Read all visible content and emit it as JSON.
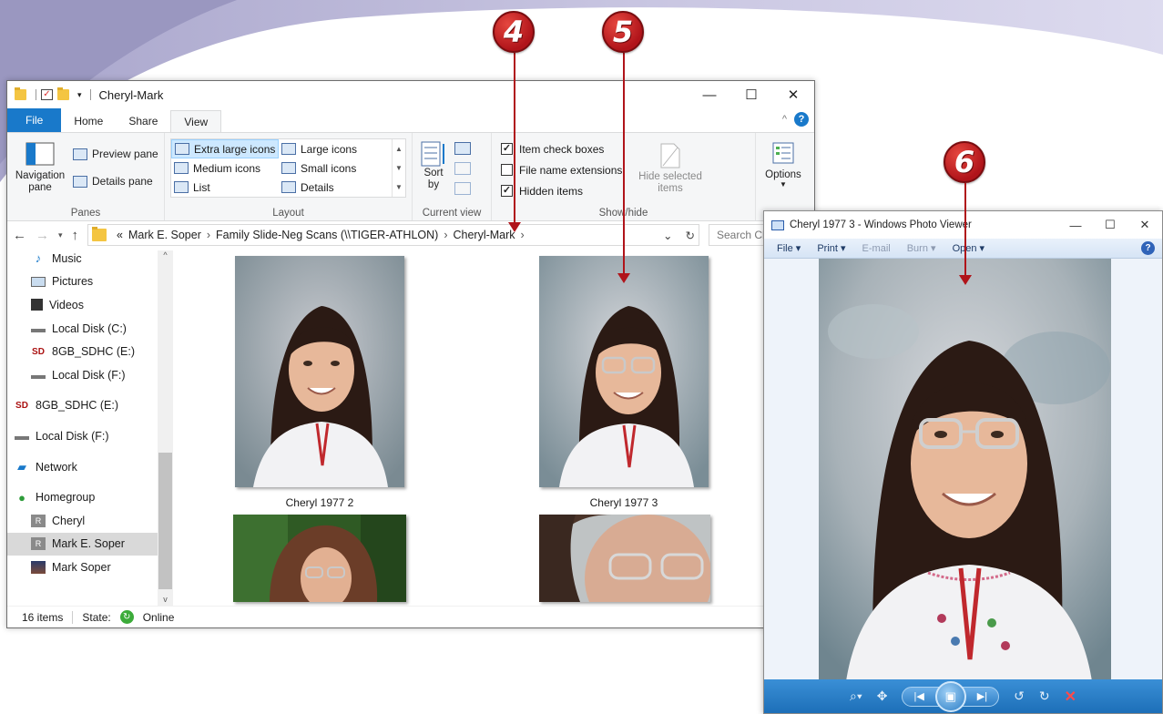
{
  "callouts": [
    "4",
    "5",
    "6"
  ],
  "explorer": {
    "title": "Cheryl-Mark",
    "tabs": [
      "File",
      "Home",
      "Share",
      "View"
    ],
    "ribbon": {
      "panes": {
        "navigation_pane": "Navigation pane",
        "preview_pane": "Preview pane",
        "details_pane": "Details pane",
        "label": "Panes"
      },
      "layout": {
        "items": [
          "Extra large icons",
          "Large icons",
          "Medium icons",
          "Small icons",
          "List",
          "Details"
        ],
        "selected": "Extra large icons",
        "label": "Layout"
      },
      "current_view": {
        "sort_by": "Sort by",
        "label": "Current view"
      },
      "show_hide": {
        "checkboxes": [
          {
            "label": "Item check boxes",
            "checked": true
          },
          {
            "label": "File name extensions",
            "checked": false
          },
          {
            "label": "Hidden items",
            "checked": true
          }
        ],
        "hide_selected": "Hide selected items",
        "label": "Show/hide"
      },
      "options": "Options"
    },
    "address": {
      "overflow": "«",
      "crumbs": [
        "Mark E. Soper",
        "Family Slide-Neg Scans (\\\\TIGER-ATHLON)",
        "Cheryl-Mark"
      ],
      "search_placeholder": "Search Ch"
    },
    "nav_items": [
      {
        "label": "Music",
        "icon": "music-icon"
      },
      {
        "label": "Pictures",
        "icon": "pictures-icon"
      },
      {
        "label": "Videos",
        "icon": "videos-icon"
      },
      {
        "label": "Local Disk (C:)",
        "icon": "drive-icon"
      },
      {
        "label": "8GB_SDHC (E:)",
        "icon": "sd-card-icon"
      },
      {
        "label": "Local Disk (F:)",
        "icon": "drive-icon"
      },
      {
        "label": "8GB_SDHC (E:)",
        "icon": "sd-card-icon"
      },
      {
        "label": "Local Disk (F:)",
        "icon": "drive-icon"
      },
      {
        "label": "Network",
        "icon": "network-icon"
      },
      {
        "label": "Homegroup",
        "icon": "homegroup-icon"
      },
      {
        "label": "Cheryl",
        "icon": "user-icon"
      },
      {
        "label": "Mark E. Soper",
        "icon": "user-icon",
        "selected": true
      },
      {
        "label": "Mark Soper",
        "icon": "user-photo-icon"
      }
    ],
    "files": [
      {
        "name": "Cheryl 1977 2"
      },
      {
        "name": "Cheryl 1977 3"
      },
      {
        "name": ""
      },
      {
        "name": ""
      }
    ],
    "status": {
      "count": "16 items",
      "state_label": "State:",
      "state_value": "Online"
    }
  },
  "viewer": {
    "title": "Cheryl 1977 3 - Windows Photo Viewer",
    "menu": [
      "File",
      "Print",
      "E-mail",
      "Burn",
      "Open"
    ]
  },
  "colors": {
    "accent": "#1979ca",
    "callout": "#b0141a",
    "viewer_toolbar": "#1d6fb8"
  }
}
